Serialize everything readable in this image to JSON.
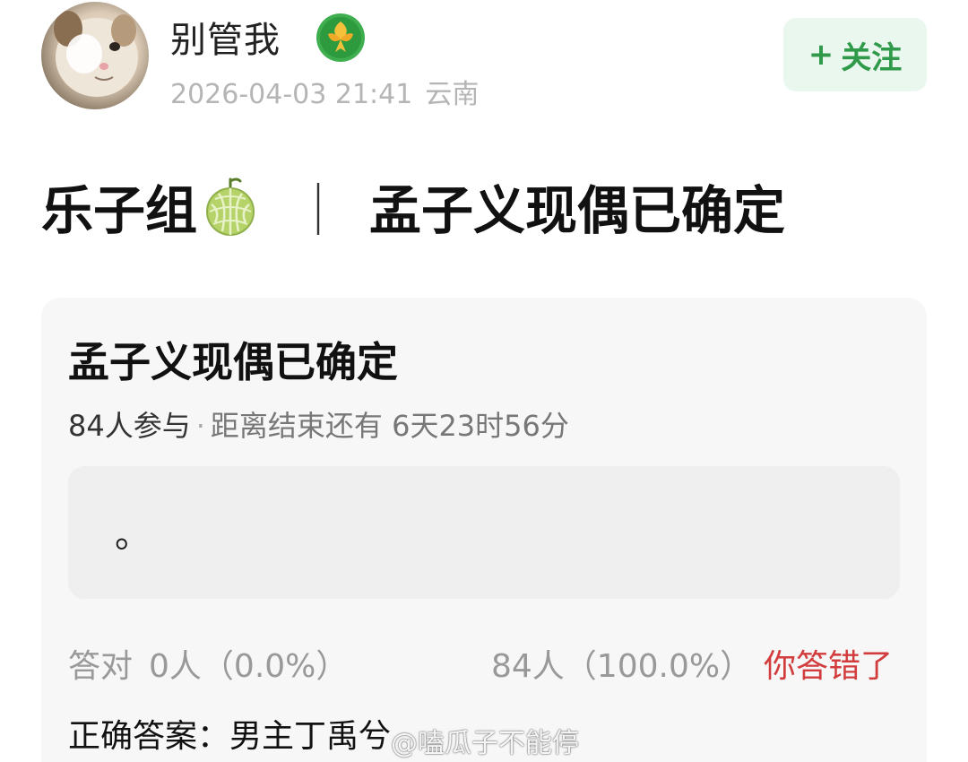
{
  "post": {
    "author": {
      "name": "别管我",
      "avatar_icon": "cat-avatar",
      "badge_icon": "flower-badge-icon"
    },
    "time": "2026-04-03 21:41",
    "location": "云南",
    "follow_label": "关注",
    "title_prefix": "乐子组",
    "title_emoji_icon": "melon-icon",
    "title_separator": "｜",
    "title_main": "孟子义现偶已确定"
  },
  "poll": {
    "title": "孟子义现偶已确定",
    "participants": "84人参与",
    "dot": "·",
    "countdown": "距离结束还有 6天23时56分",
    "option_text": "。",
    "correct_label": "答对",
    "correct_count": "0人（0.0%）",
    "wrong_count": "84人（100.0%）",
    "result_text": "你答错了",
    "answer_text": "正确答案：男主丁禹兮"
  },
  "watermark": "@嗑瓜子不能停",
  "colors": {
    "accent_green": "#2f9a4a",
    "follow_bg": "#eaf7ee",
    "wrong_red": "#d23c3c",
    "card_bg": "#f7f7f7"
  }
}
